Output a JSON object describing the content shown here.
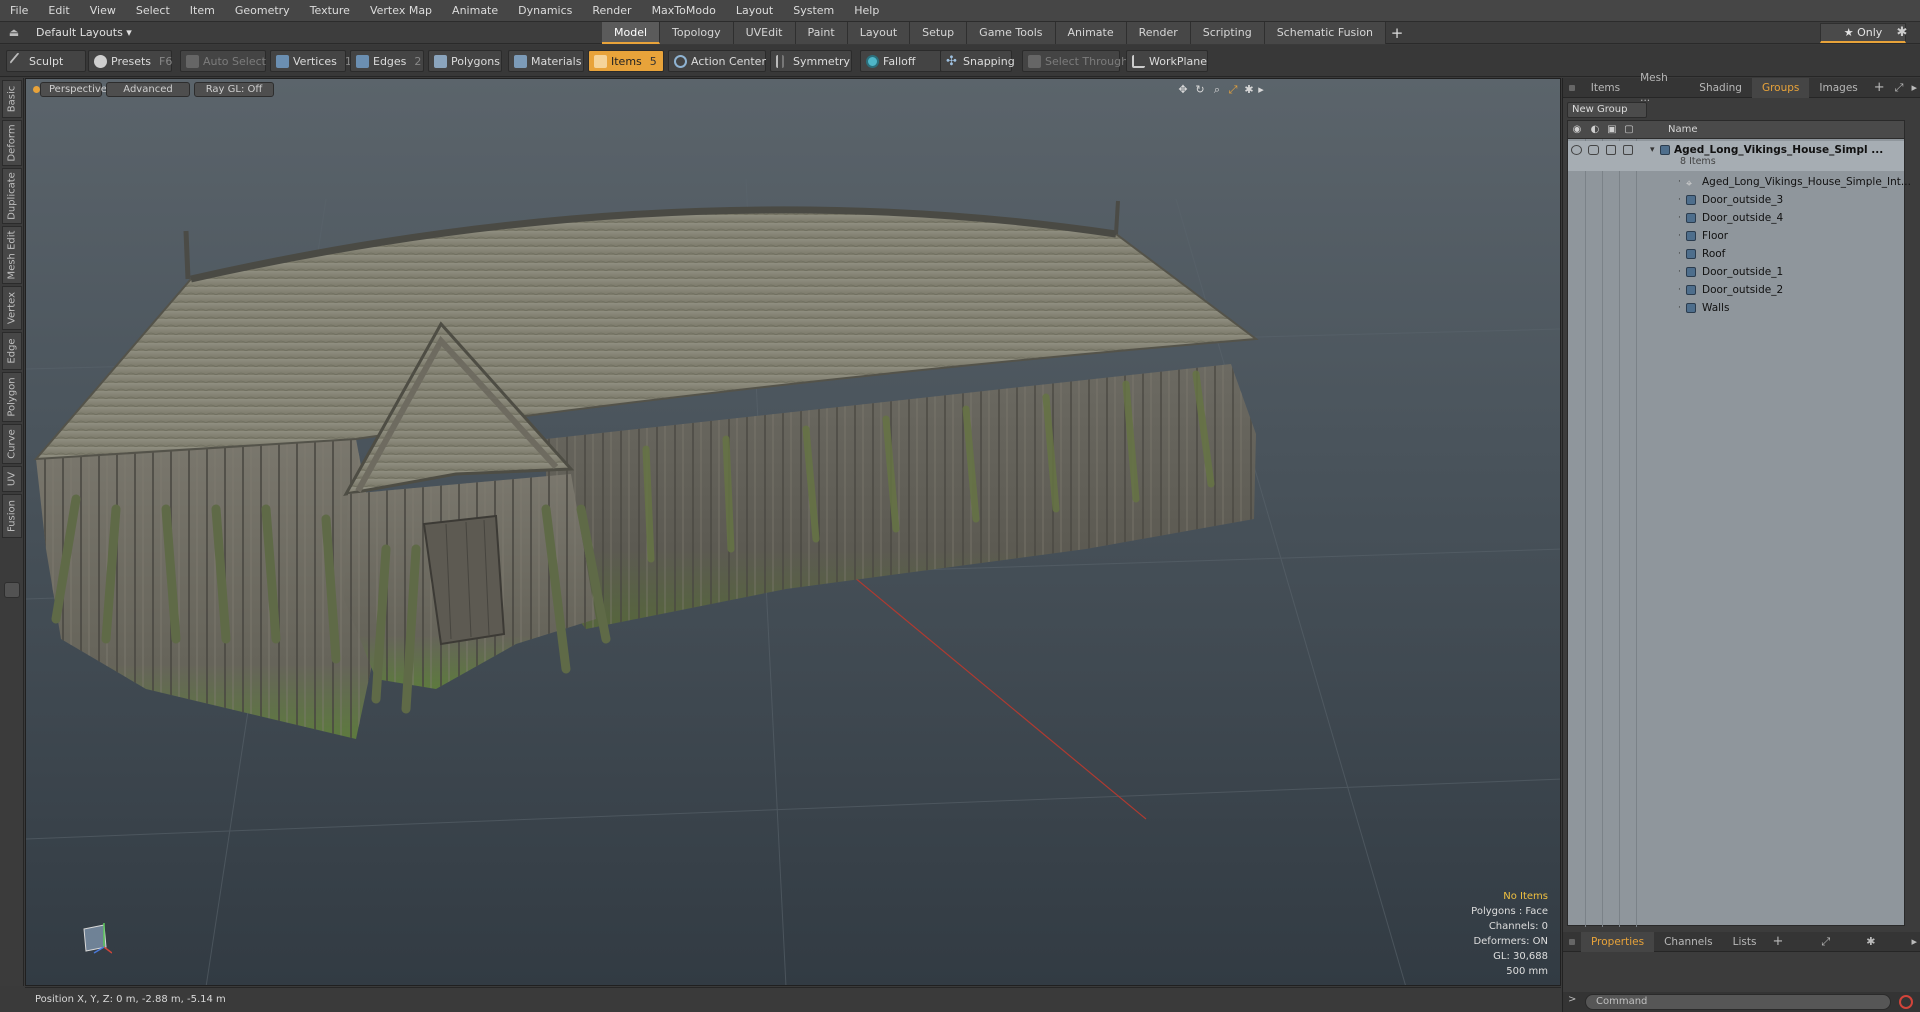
{
  "menu": [
    "File",
    "Edit",
    "View",
    "Select",
    "Item",
    "Geometry",
    "Texture",
    "Vertex Map",
    "Animate",
    "Dynamics",
    "Render",
    "MaxToModo",
    "Layout",
    "System",
    "Help"
  ],
  "layout": {
    "select_label": "Default Layouts ▾",
    "tabs": [
      "Model",
      "Topology",
      "UVEdit",
      "Paint",
      "Layout",
      "Setup",
      "Game Tools",
      "Animate",
      "Render",
      "Scripting",
      "Schematic Fusion"
    ],
    "active_tab": "Model",
    "add_label": "+",
    "only_label": "★ Only"
  },
  "toolbar": {
    "sculpt": "Sculpt",
    "presets": "Presets",
    "presets_key": "F6",
    "auto_select": "Auto Select",
    "vertices": "Vertices",
    "vertices_count": "1",
    "edges": "Edges",
    "edges_count": "2",
    "polygons": "Polygons",
    "materials": "Materials",
    "items": "Items",
    "items_count": "5",
    "action_center": "Action Center",
    "symmetry": "Symmetry",
    "falloff": "Falloff",
    "snapping": "Snapping",
    "select_through": "Select Through",
    "workplane": "WorkPlane"
  },
  "left_tabs": [
    "Basic",
    "Deform",
    "Duplicate",
    "Mesh Edit",
    "Vertex",
    "Edge",
    "Polygon",
    "Curve",
    "UV",
    "Fusion"
  ],
  "viewport": {
    "view_mode": "Perspective",
    "shading": "Advanced",
    "raygl": "Ray GL: Off",
    "info": {
      "no_items": "No Items",
      "polygons": "Polygons : Face",
      "channels": "Channels: 0",
      "deformers": "Deformers: ON",
      "gl": "GL: 30,688",
      "scale": "500 mm"
    }
  },
  "status": {
    "position": "Position X, Y, Z:   0 m, -2.88 m, -5.14 m"
  },
  "right_panel": {
    "tabs": [
      "Items",
      "Mesh ...",
      "Shading",
      "Groups",
      "Images"
    ],
    "active_tab": "Groups",
    "add_label": "+",
    "new_group": "New Group",
    "name_header": "Name",
    "root": {
      "name": "Aged_Long_Vikings_House_Simpl ...",
      "count": "8 Items"
    },
    "children": [
      "Aged_Long_Vikings_House_Simple_Int...",
      "Door_outside_3",
      "Door_outside_4",
      "Floor",
      "Roof",
      "Door_outside_1",
      "Door_outside_2",
      "Walls"
    ],
    "bottom_tabs": [
      "Properties",
      "Channels",
      "Lists"
    ],
    "bottom_active": "Properties",
    "command_placeholder": "Command"
  },
  "colors": {
    "accent": "#e8a33a",
    "info_highlight": "#f0c040"
  }
}
